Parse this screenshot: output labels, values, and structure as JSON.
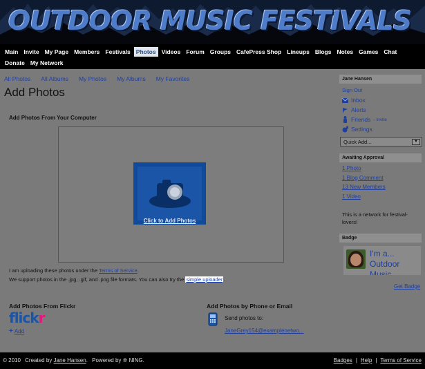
{
  "banner": {
    "title": "OUTDOOR MUSIC FESTIVALS"
  },
  "nav": {
    "row1": [
      "Main",
      "Invite",
      "My Page",
      "Members",
      "Festivals",
      "Photos",
      "Videos",
      "Forum",
      "Groups",
      "CafePress Shop",
      "Lineups",
      "Blogs",
      "Notes",
      "Games",
      "Chat"
    ],
    "row2": [
      "Donate",
      "My Network"
    ],
    "active": "Photos"
  },
  "subnav": [
    "All Photos",
    "All Albums",
    "My Photos",
    "My Albums",
    "My Favorites"
  ],
  "page_title": "Add Photos",
  "computer": {
    "heading": "Add Photos From Your Computer",
    "button_label": "Click to Add Photos",
    "tos_prefix": "I am uploading these photos under the ",
    "tos_link": "Terms of Service",
    "tos_suffix": ".",
    "formats_text": "We support photos in the .jpg, .gif, and .png file formats. You can also try the ",
    "simple_uploader": "simple uploader",
    "formats_suffix": "."
  },
  "flickr": {
    "heading": "Add Photos From Flickr",
    "logo_part1": "flick",
    "logo_part2": "r",
    "add_label": "Add"
  },
  "phone": {
    "heading": "Add Photos by Phone or Email",
    "send_text": "Send photos to:",
    "email": "JaneGrey154@examplenetwo..."
  },
  "sidebar": {
    "user_name": "Jane Hansen",
    "sign_out": "Sign Out",
    "inbox": "Inbox",
    "alerts": "Alerts",
    "friends": "Friends",
    "friends_invite": " - Invite",
    "settings": "Settings",
    "quick_add": "Quick Add...",
    "approval_heading": "Awaiting Approval",
    "approval_items": [
      "1 Photo",
      "1 Blog Comment",
      "13 New Members",
      "1 Video"
    ],
    "network_desc": "This is a network for festival-lovers!",
    "badge_heading": "Badge",
    "badge_text": "I'm a... Outdoor Music",
    "get_badge": "Get Badge"
  },
  "footer": {
    "copyright": "© 2010",
    "created_by": "Created by",
    "creator": "Jane Hansen",
    "powered_by": "Powered by",
    "ning": "NING.",
    "links": [
      "Badges",
      "Help",
      "Terms of Service"
    ]
  },
  "colors": {
    "link": "#1e3fa0",
    "nav_bg": "#000000",
    "active_tab": "#dfe6ee",
    "camera_button": "#104a9a"
  }
}
